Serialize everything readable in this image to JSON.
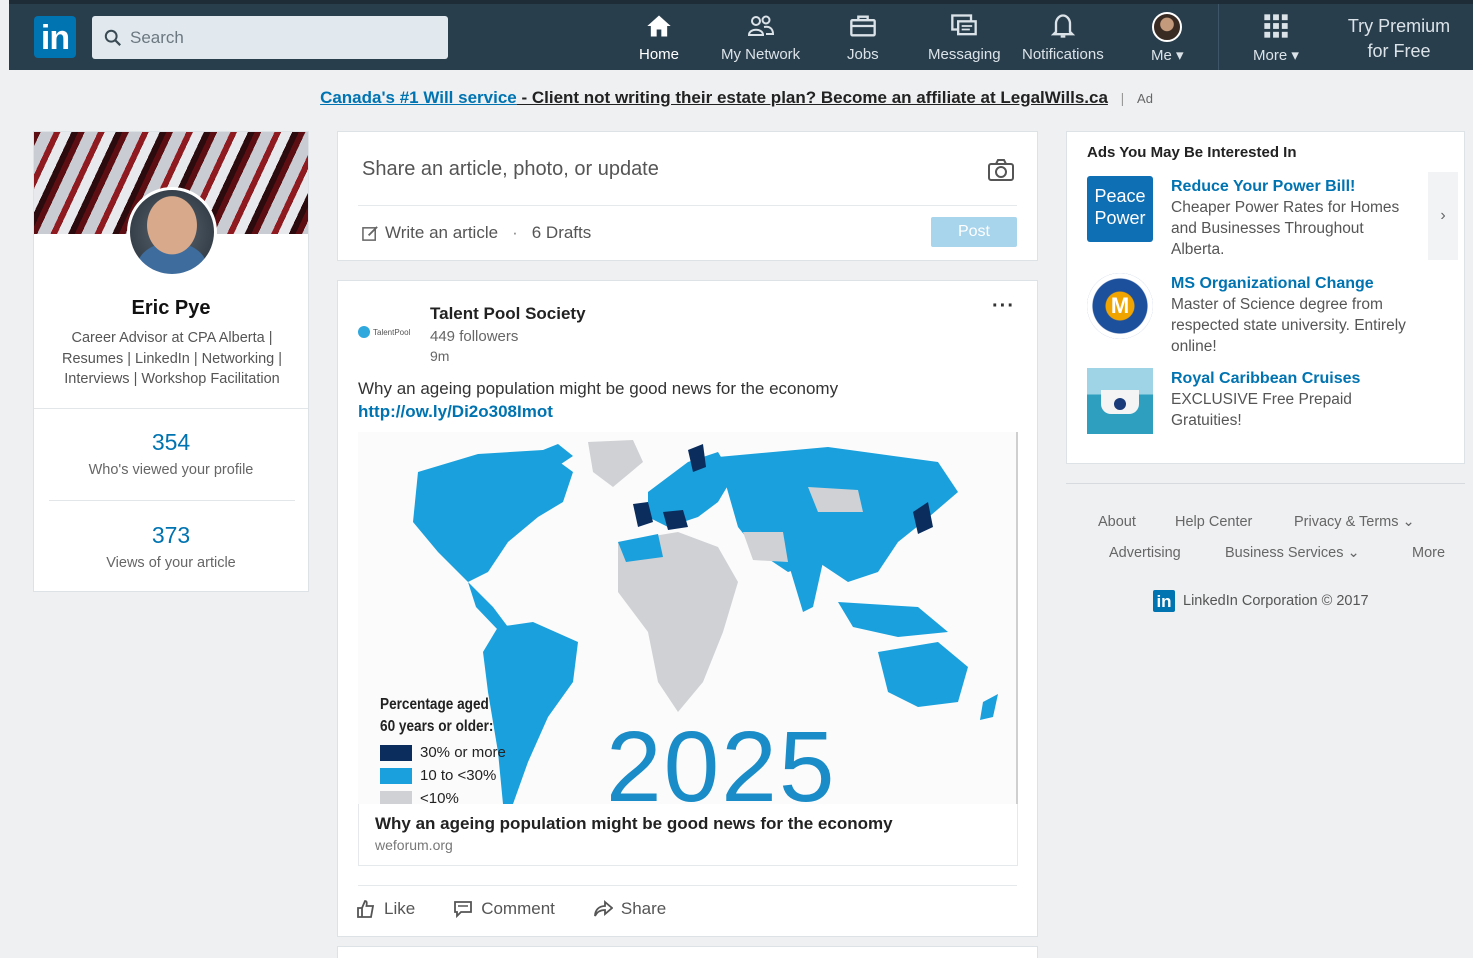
{
  "nav": {
    "search_placeholder": "Search",
    "items": [
      {
        "label": "Home",
        "icon": "home-icon"
      },
      {
        "label": "My Network",
        "icon": "people-icon"
      },
      {
        "label": "Jobs",
        "icon": "briefcase-icon"
      },
      {
        "label": "Messaging",
        "icon": "messaging-icon"
      },
      {
        "label": "Notifications",
        "icon": "bell-icon"
      },
      {
        "label": "Me ▾",
        "icon": "avatar"
      },
      {
        "label": "More ▾",
        "icon": "grid-icon"
      }
    ],
    "premium_line1": "Try Premium",
    "premium_line2": "for Free"
  },
  "banner": {
    "link": "Canada's #1 Will service",
    "text": " - Client not writing their estate plan? Become an affiliate at LegalWills.ca",
    "separator": "|",
    "tag": "Ad"
  },
  "profile": {
    "name": "Eric Pye",
    "headline": "Career Advisor at CPA Alberta | Resumes | LinkedIn | Networking | Interviews | Workshop Facilitation",
    "views_count": "354",
    "views_label": "Who's viewed your profile",
    "article_count": "373",
    "article_label": "Views of your article"
  },
  "share": {
    "prompt": "Share an article, photo, or update",
    "write": "Write an article",
    "dot": "·",
    "drafts": "6 Drafts",
    "post": "Post"
  },
  "post": {
    "logo_text": "TalentPool",
    "author": "Talent Pool Society",
    "followers": "449 followers",
    "time": "9m",
    "menu": "···",
    "text": "Why an ageing population might be good news for the economy ",
    "link": "http://ow.ly/Di2o308Imot",
    "legend_title1": "Percentage aged",
    "legend_title2": "60 years or older:",
    "legend": [
      {
        "label": "30% or more",
        "color": "#0b2d5e"
      },
      {
        "label": "10 to <30%",
        "color": "#1aa0dc"
      },
      {
        "label": "<10%",
        "color": "#cfd1d4"
      }
    ],
    "year": "2025",
    "card_title": "Why an ageing population might be good news for the economy",
    "card_domain": "weforum.org",
    "actions": [
      "Like",
      "Comment",
      "Share"
    ]
  },
  "ads": {
    "title": "Ads You May Be Interested In",
    "items": [
      {
        "head": "Reduce Your Power Bill!",
        "body": "Cheaper Power Rates for Homes and Businesses Throughout Alberta.",
        "logo_line1": "Peace",
        "logo_line2": "Power"
      },
      {
        "head": "MS Organizational Change",
        "body": "Master of Science degree from respected state university. Entirely online!",
        "logo_letter": "M"
      },
      {
        "head": "Royal Caribbean Cruises",
        "body": "EXCLUSIVE Free Prepaid Gratuities!"
      }
    ],
    "arrow": "›"
  },
  "footer": {
    "about": "About",
    "help": "Help Center",
    "privacy": "Privacy & Terms ⌄",
    "advertising": "Advertising",
    "business": "Business Services ⌄",
    "more": "More",
    "corp": "LinkedIn Corporation © 2017"
  }
}
